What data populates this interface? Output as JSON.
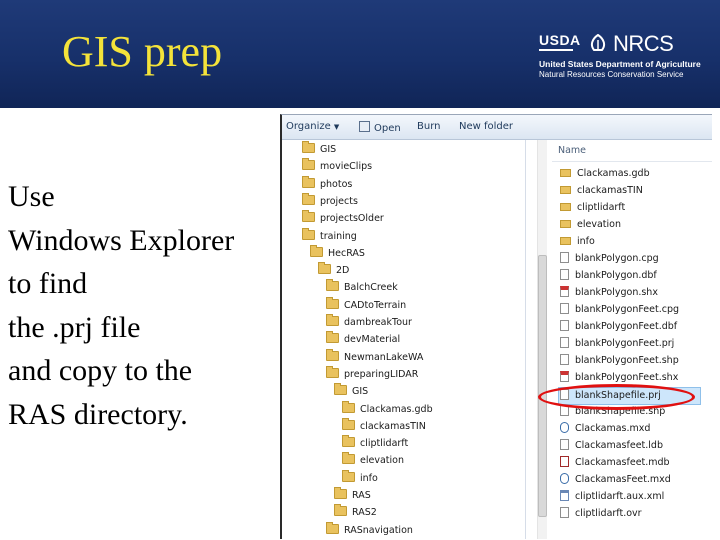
{
  "slide": {
    "title": "GIS prep",
    "body_lines": [
      "Use",
      "Windows Explorer",
      "to find",
      "the .prj file",
      "and copy to the",
      "RAS directory."
    ]
  },
  "logo": {
    "agency_short": "USDA",
    "service_short": "NRCS",
    "line1": "United States Department of Agriculture",
    "line2": "Natural Resources Conservation Service"
  },
  "colors": {
    "header_bg": "#17306a",
    "title_color": "#f4e33a",
    "highlight_ring": "#e01010",
    "selection_bg": "#cde6fb"
  },
  "explorer": {
    "toolbar": {
      "organize": "Organize",
      "open": "Open",
      "burn": "Burn",
      "new_folder": "New folder"
    },
    "nav_tree": [
      {
        "label": "GIS",
        "level": 0
      },
      {
        "label": "movieClips",
        "level": 0
      },
      {
        "label": "photos",
        "level": 0
      },
      {
        "label": "projects",
        "level": 0
      },
      {
        "label": "projectsOlder",
        "level": 0
      },
      {
        "label": "training",
        "level": 0
      },
      {
        "label": "HecRAS",
        "level": 1
      },
      {
        "label": "2D",
        "level": 2
      },
      {
        "label": "BalchCreek",
        "level": 3
      },
      {
        "label": "CADtoTerrain",
        "level": 3
      },
      {
        "label": "dambreakTour",
        "level": 3
      },
      {
        "label": "devMaterial",
        "level": 3
      },
      {
        "label": "NewmanLakeWA",
        "level": 3
      },
      {
        "label": "preparingLIDAR",
        "level": 3
      },
      {
        "label": "GIS",
        "level": 4
      },
      {
        "label": "Clackamas.gdb",
        "level": 5
      },
      {
        "label": "clackamasTIN",
        "level": 5
      },
      {
        "label": "cliptlidarft",
        "level": 5
      },
      {
        "label": "elevation",
        "level": 5
      },
      {
        "label": "info",
        "level": 5
      },
      {
        "label": "RAS",
        "level": 4
      },
      {
        "label": "RAS2",
        "level": 4
      },
      {
        "label": "RASnavigation",
        "level": 3
      }
    ],
    "files_header": "Name",
    "files": [
      {
        "name": "Clackamas.gdb",
        "icon": "folder-icon"
      },
      {
        "name": "clackamasTIN",
        "icon": "folder-icon"
      },
      {
        "name": "cliptlidarft",
        "icon": "folder-icon"
      },
      {
        "name": "elevation",
        "icon": "folder-icon"
      },
      {
        "name": "info",
        "icon": "folder-icon"
      },
      {
        "name": "blankPolygon.cpg",
        "icon": "file-icon"
      },
      {
        "name": "blankPolygon.dbf",
        "icon": "file-icon"
      },
      {
        "name": "blankPolygon.shx",
        "icon": "shapefile-icon"
      },
      {
        "name": "blankPolygonFeet.cpg",
        "icon": "file-icon"
      },
      {
        "name": "blankPolygonFeet.dbf",
        "icon": "file-icon"
      },
      {
        "name": "blankPolygonFeet.prj",
        "icon": "file-icon"
      },
      {
        "name": "blankPolygonFeet.shp",
        "icon": "file-icon"
      },
      {
        "name": "blankPolygonFeet.shx",
        "icon": "shapefile-icon"
      },
      {
        "name": "blankShapefile.prj",
        "icon": "file-icon",
        "selected": true
      },
      {
        "name": "blankShapefile.shp",
        "icon": "file-icon"
      },
      {
        "name": "Clackamas.mxd",
        "icon": "mxd-icon"
      },
      {
        "name": "Clackamasfeet.ldb",
        "icon": "file-icon"
      },
      {
        "name": "Clackamasfeet.mdb",
        "icon": "mdb-icon"
      },
      {
        "name": "ClackamasFeet.mxd",
        "icon": "mxd-icon"
      },
      {
        "name": "cliptlidarft.aux.xml",
        "icon": "xml-icon"
      },
      {
        "name": "cliptlidarft.ovr",
        "icon": "file-icon"
      }
    ]
  }
}
